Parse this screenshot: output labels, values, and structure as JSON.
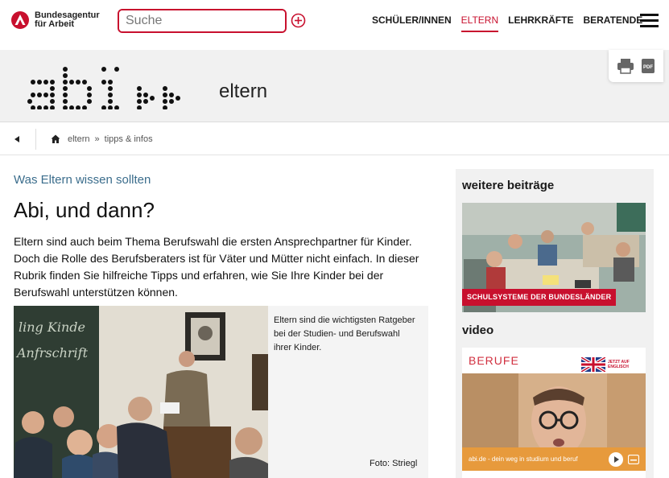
{
  "header": {
    "logo_line1": "Bundesagentur",
    "logo_line2": "für Arbeit",
    "search_placeholder": "Suche",
    "nav": [
      {
        "label": "SCHÜLER/INNEN",
        "active": false
      },
      {
        "label": "ELTERN",
        "active": true
      },
      {
        "label": "LEHRKRÄFTE",
        "active": false
      },
      {
        "label": "BERATENDE",
        "active": false
      }
    ]
  },
  "banner": {
    "section_title": "eltern",
    "pdf_label": "PDF"
  },
  "breadcrumb": {
    "items": [
      "eltern",
      "tipps & infos"
    ],
    "separator": "»"
  },
  "article": {
    "kicker": "Was Eltern wissen sollten",
    "headline": "Abi, und dann?",
    "intro": "Eltern sind auch beim Thema Berufswahl die ersten Ansprechpartner für Kinder. Doch die Rolle des Berufsberaters ist für Väter und Mütter nicht einfach. In dieser Rubrik finden Sie hilfreiche Tipps und erfahren, wie Sie Ihre Kinder bei der Berufswahl unterstützen können.",
    "image_caption": "Eltern sind die wichtigsten Ratgeber bei der Studien- und Berufswahl ihrer Kinder.",
    "image_credit": "Foto: Striegl"
  },
  "sidebar": {
    "more_title": "weitere beiträge",
    "card_tag": "SCHULSYSTEME DER BUNDESLÄNDER",
    "video_title": "video",
    "video_brand": "BERUFE",
    "video_badge_line1": "JETZT AUF",
    "video_badge_line2": "ENGLISCH",
    "video_caption": "abi.de - dein weg in studium und beruf"
  },
  "colors": {
    "brand_red": "#c8102e",
    "kicker_blue": "#3b6d8c",
    "video_orange": "#e79a3c"
  }
}
